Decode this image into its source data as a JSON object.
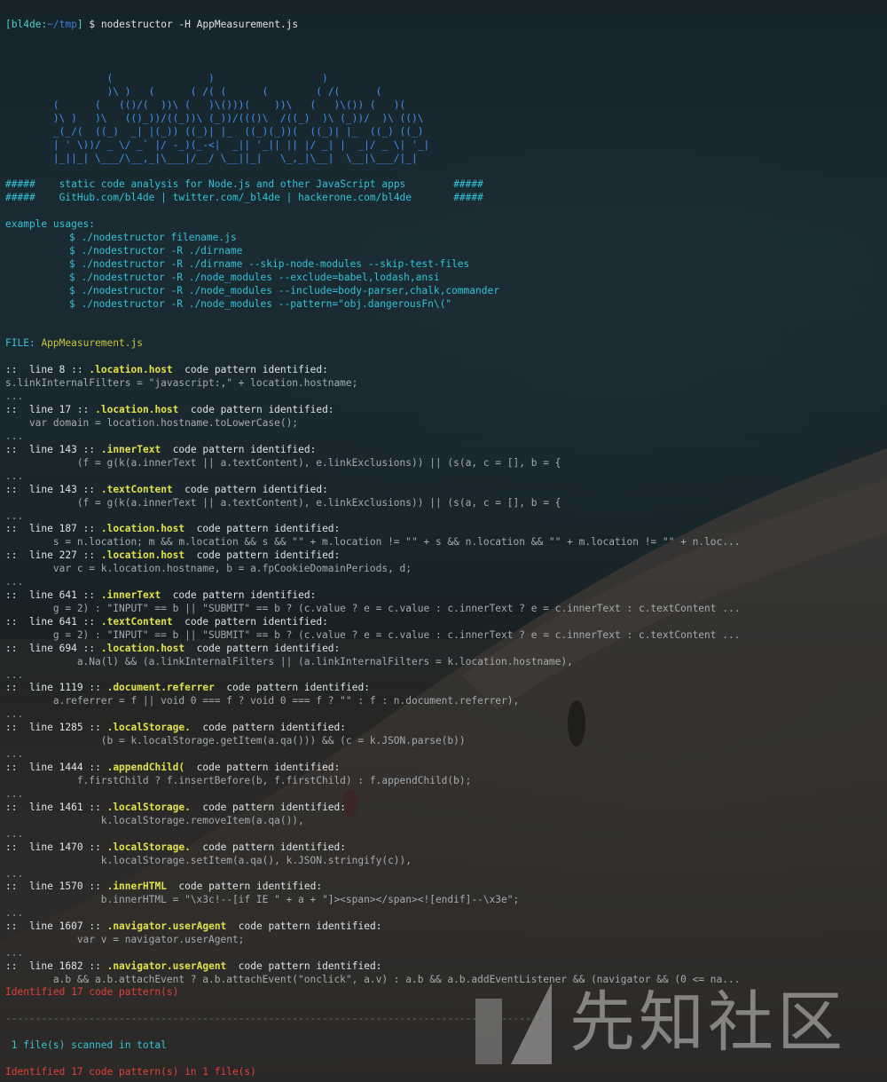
{
  "prompt": {
    "user_host": "bl4de",
    "path": "~/tmp",
    "open_bracket": "[",
    "close_bracket": "]",
    "colon": ":",
    "symbol": "$",
    "command": "nodestructor -H AppMeasurement.js"
  },
  "banner": {
    "ascii": [
      "                 (                )                  )",
      "                 )\\ )   (      ( /( (      (        ( /(      (",
      "        (      (   (()/(  ))\\ (   )\\()))(    ))\\   (   )\\()) (   )(",
      "        )\\ )   )\\   (()_))/((_))\\ (_))/((()\\  /((_)  )\\ (_))/  )\\ (()\\",
      "        _(_/(  ((_)  _| |(_)) ((_)| |_  ((_)(_))(  ((_)| |_  ((_) ((_)",
      "        | ' \\))/ _ \\/ _` |/ -_)(_-<|  _|| '_|| || |/ _| |  _|/ _ \\| '_|",
      "        |_||_| \\___/\\__,_|\\___|/__/ \\__||_|   \\_,_|\\__|  \\__|\\___/|_|"
    ],
    "hash_left": "#####",
    "hash_right": "#####",
    "tagline": "static code analysis for Node.js and other JavaScript apps",
    "links": "GitHub.com/bl4de | twitter.com/_bl4de | hackerone.com/bl4de"
  },
  "usage": {
    "heading": "example usages:",
    "examples": [
      "$ ./nodestructor filename.js",
      "$ ./nodestructor -R ./dirname",
      "$ ./nodestructor -R ./dirname --skip-node-modules --skip-test-files",
      "$ ./nodestructor -R ./node_modules --exclude=babel,lodash,ansi",
      "$ ./nodestructor -R ./node_modules --include=body-parser,chalk,commander",
      "$ ./nodestructor -R ./node_modules --pattern=\"obj.dangerousFn\\(\""
    ]
  },
  "file": {
    "label": "FILE:",
    "name": "AppMeasurement.js"
  },
  "finding_prefix": "::  line",
  "finding_sep": "::",
  "finding_suffix": "code pattern identified:",
  "ellipsis": "...",
  "findings": [
    {
      "line": "8",
      "pattern": ".location.host",
      "code": "s.linkInternalFilters = \"javascript:,\" + location.hostname;"
    },
    {
      "line": "17",
      "pattern": ".location.host",
      "code": "    var domain = location.hostname.toLowerCase();"
    },
    {
      "line": "143",
      "pattern": ".innerText",
      "code": "            (f = g(k(a.innerText || a.textContent), e.linkExclusions)) || (s(a, c = [], b = {"
    },
    {
      "line": "143",
      "pattern": ".textContent",
      "code": "            (f = g(k(a.innerText || a.textContent), e.linkExclusions)) || (s(a, c = [], b = {"
    },
    {
      "line": "187",
      "pattern": ".location.host",
      "code": "        s = n.location; m && m.location && s && \"\" + m.location != \"\" + s && n.location && \"\" + m.location != \"\" + n.loc..."
    },
    {
      "line": "227",
      "pattern": ".location.host",
      "code": "        var c = k.location.hostname, b = a.fpCookieDomainPeriods, d;"
    },
    {
      "line": "641",
      "pattern": ".innerText",
      "code": "        g = 2) : \"INPUT\" == b || \"SUBMIT\" == b ? (c.value ? e = c.value : c.innerText ? e = c.innerText : c.textContent ..."
    },
    {
      "line": "641",
      "pattern": ".textContent",
      "code": "        g = 2) : \"INPUT\" == b || \"SUBMIT\" == b ? (c.value ? e = c.value : c.innerText ? e = c.innerText : c.textContent ..."
    },
    {
      "line": "694",
      "pattern": ".location.host",
      "code": "            a.Na(l) && (a.linkInternalFilters || (a.linkInternalFilters = k.location.hostname),"
    },
    {
      "line": "1119",
      "pattern": ".document.referrer",
      "code": "        a.referrer = f || void 0 === f ? void 0 === f ? \"\" : f : n.document.referrer),"
    },
    {
      "line": "1285",
      "pattern": ".localStorage.",
      "code": "                (b = k.localStorage.getItem(a.qa())) && (c = k.JSON.parse(b))"
    },
    {
      "line": "1444",
      "pattern": ".appendChild(",
      "code": "            f.firstChild ? f.insertBefore(b, f.firstChild) : f.appendChild(b);"
    },
    {
      "line": "1461",
      "pattern": ".localStorage.",
      "code": "                k.localStorage.removeItem(a.qa()),"
    },
    {
      "line": "1470",
      "pattern": ".localStorage.",
      "code": "                k.localStorage.setItem(a.qa(), k.JSON.stringify(c)),"
    },
    {
      "line": "1570",
      "pattern": ".innerHTML",
      "code": "                b.innerHTML = \"\\x3c!--[if IE \" + a + \"]><span></span><![endif]--\\x3e\";"
    },
    {
      "line": "1607",
      "pattern": ".navigator.userAgent",
      "code": "            var v = navigator.userAgent;"
    },
    {
      "line": "1682",
      "pattern": ".navigator.userAgent",
      "code": "        a.b && a.b.attachEvent ? a.b.attachEvent(\"onclick\", a.v) : a.b && a.b.addEventListener && (navigator && (0 <= na..."
    }
  ],
  "summary": {
    "identified": "Identified 17 code pattern(s)",
    "separator": "--------------------------------------------------------------------------------------------------------",
    "scanned": " 1 file(s) scanned in total",
    "total": "Identified 17 code pattern(s) in 1 file(s)"
  },
  "watermark": {
    "text": "先知社区"
  },
  "colors": {
    "prompt_user": "#4fd1c5",
    "prompt_path": "#3f7bd7",
    "banner": "#3f8ef0",
    "tagline": "#33c3d8",
    "usage": "#33c3d8",
    "file_name": "#c6c53a",
    "pattern": "#e2e14b",
    "code": "#a3aab0",
    "error": "#e0403a",
    "background": "#1b2a31"
  }
}
